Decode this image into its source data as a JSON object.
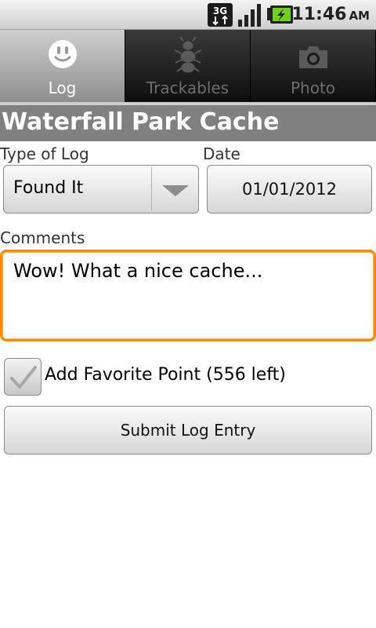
{
  "status_bar": {
    "network_label": "3G",
    "time": "11:46",
    "ampm": "AM",
    "icons": [
      "network-3g-icon",
      "signal-strength-icon",
      "battery-charging-icon"
    ]
  },
  "tabs": [
    {
      "label": "Log",
      "icon": "smiley-icon",
      "active": true
    },
    {
      "label": "Trackables",
      "icon": "travel-bug-icon",
      "active": false
    },
    {
      "label": "Photo",
      "icon": "camera-icon",
      "active": false
    }
  ],
  "title": "Waterfall Park Cache",
  "form": {
    "type_label": "Type of Log",
    "type_value": "Found It",
    "date_label": "Date",
    "date_value": "01/01/2012",
    "comments_label": "Comments",
    "comments_value": "Wow! What a nice cache...",
    "favorite_label": "Add Favorite Point (556 left)",
    "favorite_checked": true,
    "submit_label": "Submit Log Entry"
  },
  "colors": {
    "focus_orange": "#ff8a00",
    "title_bar": "#808080",
    "battery_green": "#6fd21a"
  }
}
